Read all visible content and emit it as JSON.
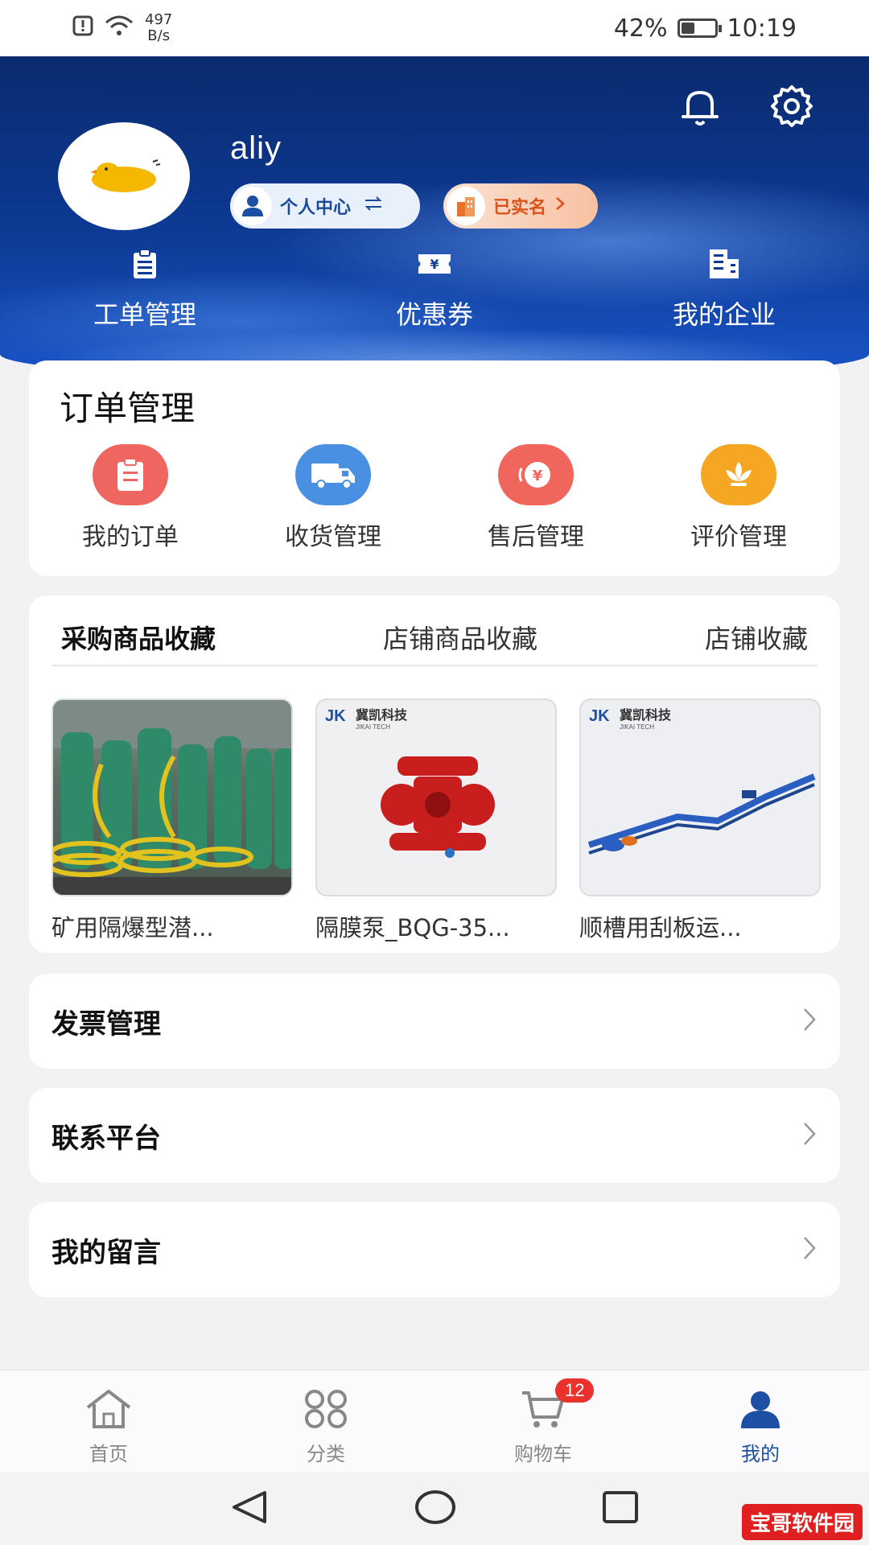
{
  "status_bar": {
    "speed_value": "497",
    "speed_unit": "B/s",
    "battery": "42%",
    "battery_level": 0.42,
    "time": "10:19"
  },
  "header": {
    "username": "aliy",
    "personal_center": "个人中心",
    "verified": "已实名",
    "quick_links": [
      {
        "label": "工单管理",
        "icon": "clipboard-icon"
      },
      {
        "label": "优惠券",
        "icon": "coupon-icon"
      },
      {
        "label": "我的企业",
        "icon": "building-icon"
      }
    ]
  },
  "orders": {
    "title": "订单管理",
    "items": [
      {
        "label": "我的订单",
        "icon": "order-icon",
        "color": "#ef6560"
      },
      {
        "label": "收货管理",
        "icon": "truck-icon",
        "color": "#4a90e2"
      },
      {
        "label": "售后管理",
        "icon": "after-sale-icon",
        "color": "#f0655c"
      },
      {
        "label": "评价管理",
        "icon": "flower-icon",
        "color": "#f5a623"
      }
    ]
  },
  "favorites": {
    "tabs": [
      "采购商品收藏",
      "店铺商品收藏",
      "店铺收藏"
    ],
    "items": [
      {
        "name": "矿用隔爆型潜..."
      },
      {
        "name": "隔膜泵_BQG-35..."
      },
      {
        "name": "顺槽用刮板运..."
      }
    ],
    "brand_text": "冀凯科技",
    "brand_sub": "JIKAI TECH"
  },
  "menu": [
    {
      "label": "发票管理"
    },
    {
      "label": "联系平台"
    },
    {
      "label": "我的留言"
    }
  ],
  "bottom_nav": {
    "items": [
      {
        "label": "首页",
        "icon": "home-icon"
      },
      {
        "label": "分类",
        "icon": "category-icon"
      },
      {
        "label": "购物车",
        "icon": "cart-icon"
      },
      {
        "label": "我的",
        "icon": "user-icon"
      }
    ],
    "cart_badge": "12",
    "active_color": "#1d4fa3"
  },
  "watermark": "宝哥软件园"
}
